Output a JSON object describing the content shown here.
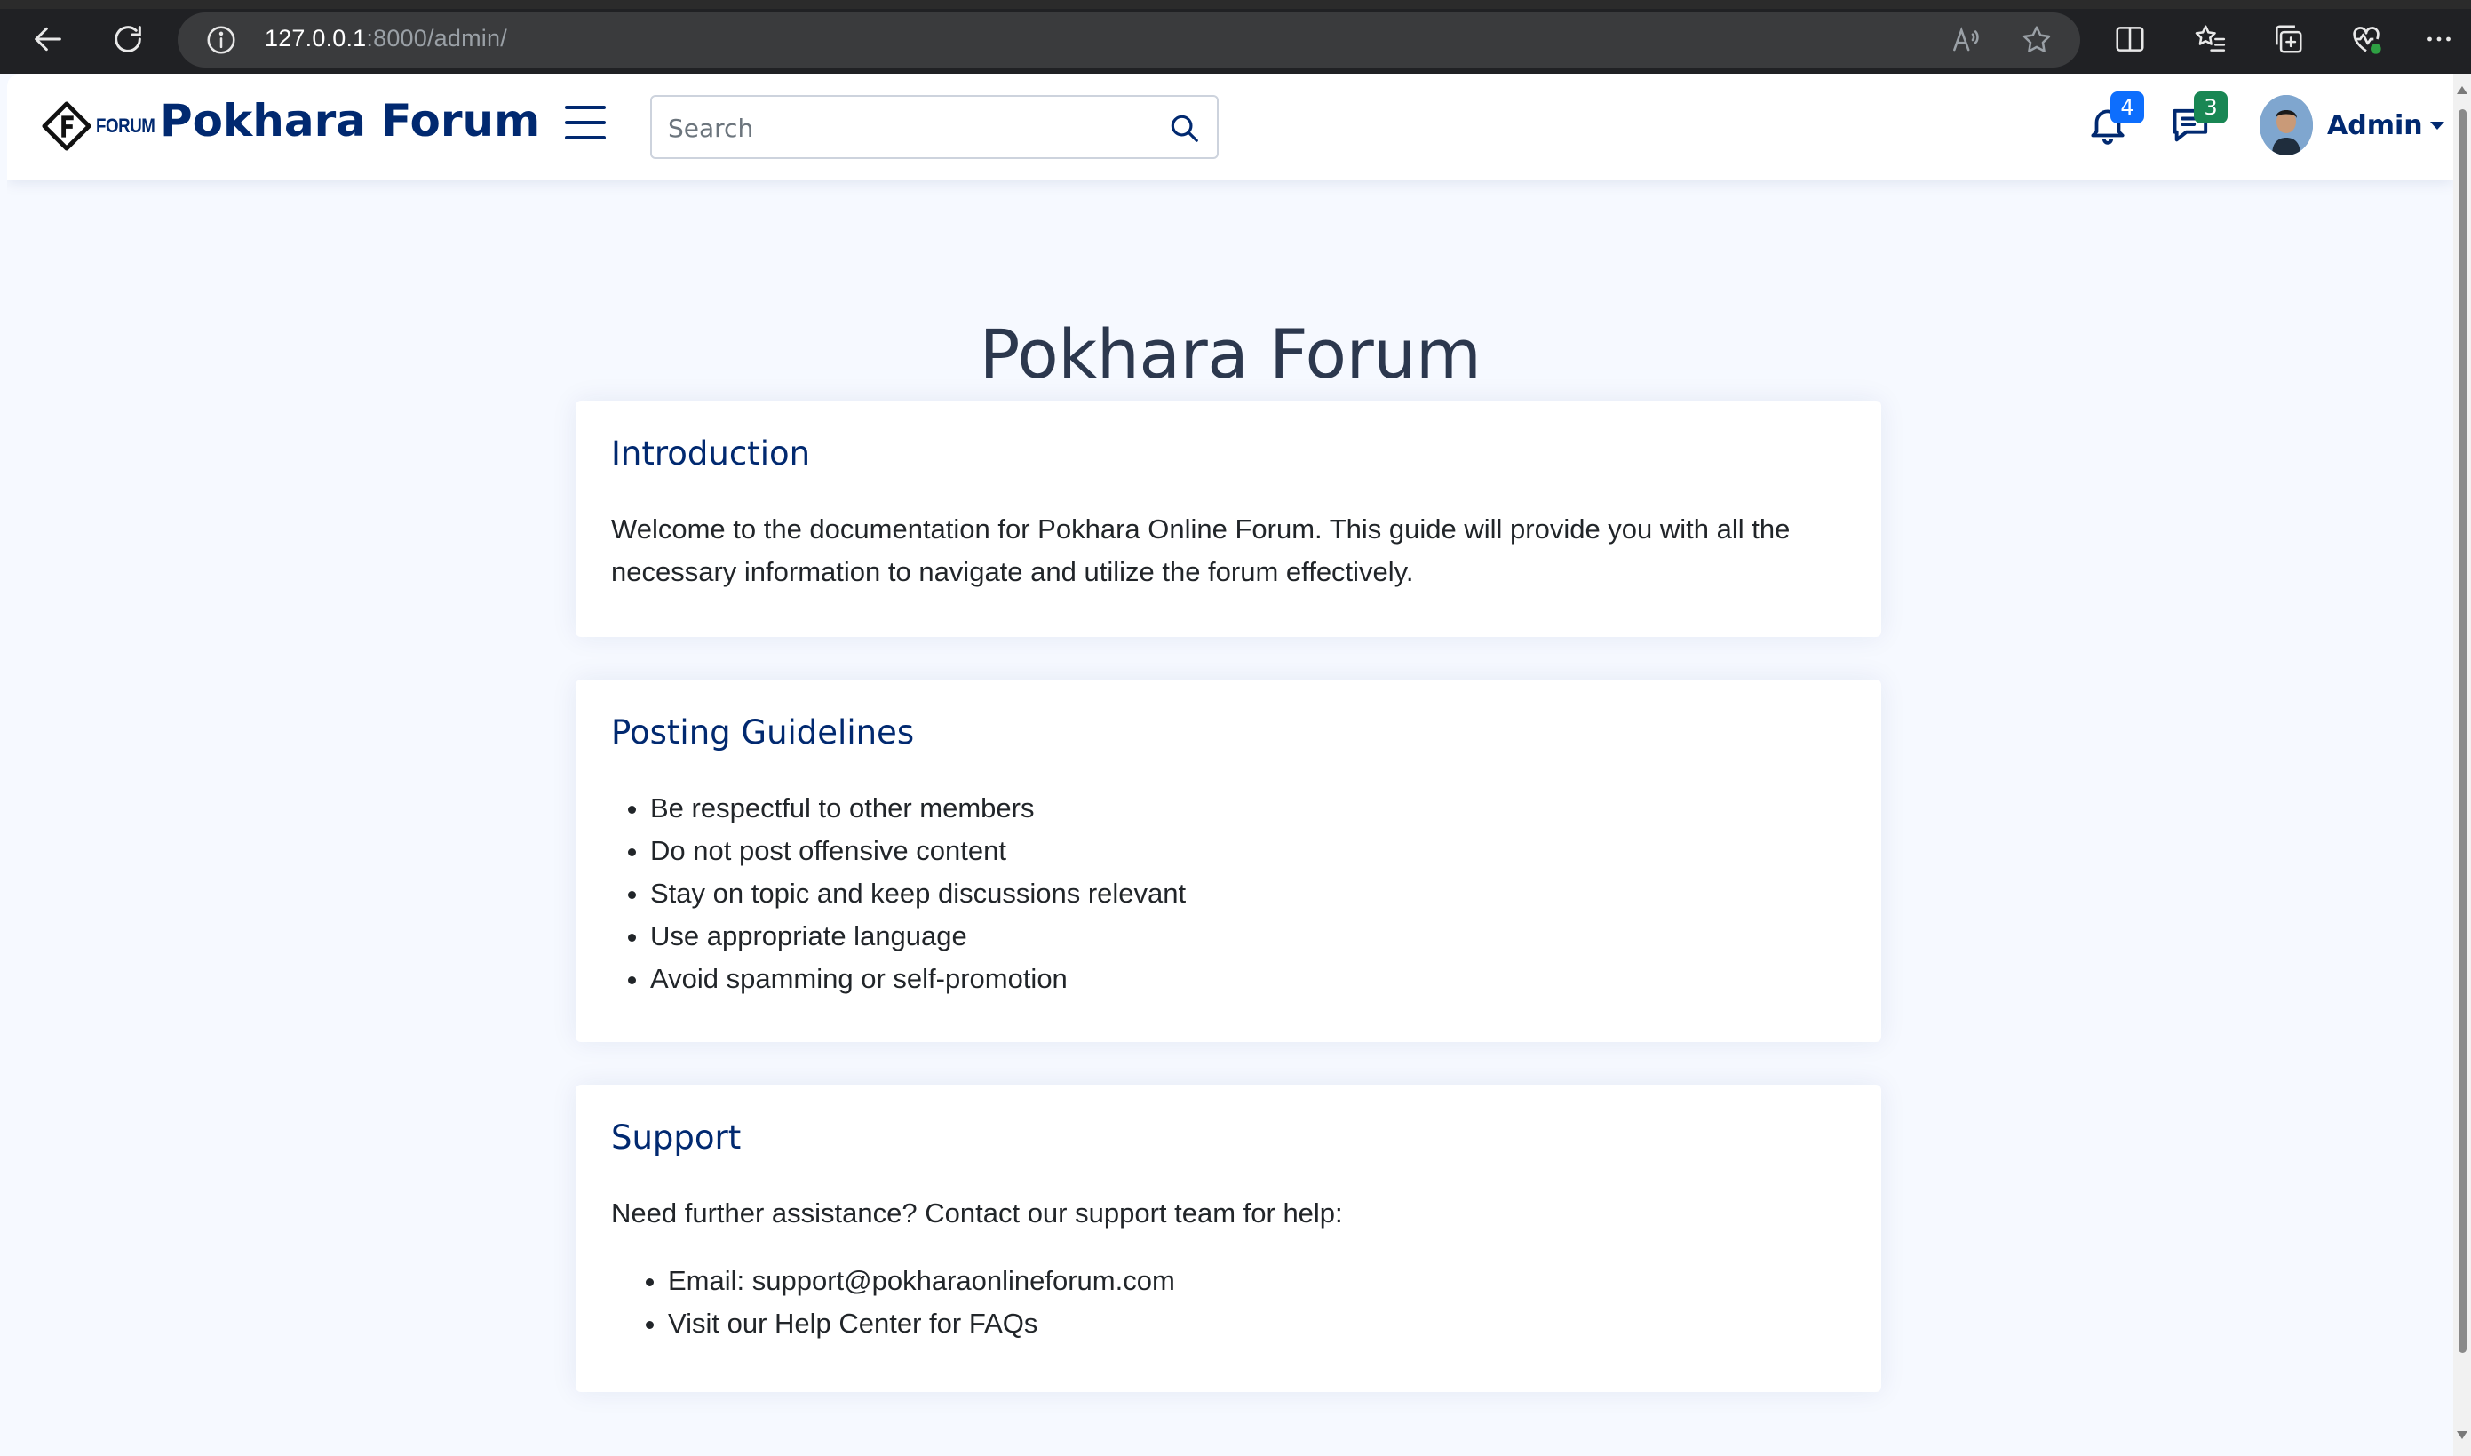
{
  "browser": {
    "url_host": "127.0.0.1",
    "url_rest": ":8000/admin/"
  },
  "header": {
    "logo_small": "FORUM",
    "brand": "Pokhara Forum",
    "search_placeholder": "Search",
    "notifications_count": "4",
    "messages_count": "3",
    "profile_name": "Admin"
  },
  "colors": {
    "brand": "#012970",
    "notification_badge": "#0d6efd",
    "message_badge": "#198754",
    "page_bg": "#f6f9ff"
  },
  "main": {
    "title": "Pokhara Forum",
    "intro": {
      "heading": "Introduction",
      "text": "Welcome to the documentation for Pokhara Online Forum. This guide will provide you with all the necessary information to navigate and utilize the forum effectively."
    },
    "guidelines": {
      "heading": "Posting Guidelines",
      "items": [
        "Be respectful to other members",
        "Do not post offensive content",
        "Stay on topic and keep discussions relevant",
        "Use appropriate language",
        "Avoid spamming or self-promotion"
      ]
    },
    "support": {
      "heading": "Support",
      "text": "Need further assistance? Contact our support team for help:",
      "items": [
        "Email: support@pokharaonlineforum.com",
        "Visit our Help Center for FAQs"
      ]
    }
  }
}
